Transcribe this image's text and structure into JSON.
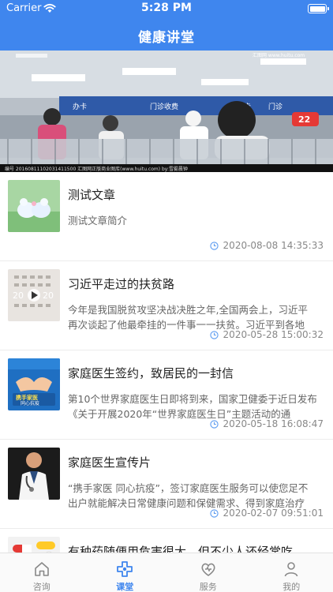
{
  "status_bar": {
    "carrier": "Carrier",
    "time": "5:28 PM"
  },
  "nav": {
    "title": "健康讲堂"
  },
  "banner": {
    "caption": "编号 20160811102031411500  汇图网正版商业图库(www.huitu.com) by:雪雾晨钟",
    "watermark": "汇图网 www.huitu.com",
    "sign_text": "门诊收费",
    "sign_number": "22"
  },
  "articles": [
    {
      "title": "测试文章",
      "summary": "测试文章简介",
      "date": "2020-08-08 14:35:33"
    },
    {
      "title": "习近平走过的扶贫路",
      "summary": "今年是我国脱贫攻坚决战决胜之年,全国两会上，习近平再次谈起了他最牵挂的一件事一一扶贫。习近平到各地考...",
      "date": "2020-05-28 15:00:32"
    },
    {
      "title": "家庭医生签约，致居民的一封信",
      "summary": "第10个世界家庭医生日即将到来，国家卫健委于近日发布《关于开展2020年“世界家庭医生日”主题活动的通知》...",
      "date": "2020-05-18 16:08:47"
    },
    {
      "title": "家庭医生宣传片",
      "summary": "“携手家医 同心抗疫”，签订家庭医生服务可以使您足不出户就能解决日常健康问题和保健需求、得到家庭治疗和...",
      "date": "2020-02-07 09:51:01"
    },
    {
      "title": "有种药随便用危害很大，但不少人还经常吃",
      "summary": "",
      "date": ""
    }
  ],
  "thumb_text": {
    "poster_line1": "携手家医",
    "poster_line2": "同心抗疫"
  },
  "tabs": [
    {
      "label": "咨询",
      "icon": "home-icon"
    },
    {
      "label": "课堂",
      "icon": "health-cross-icon"
    },
    {
      "label": "服务",
      "icon": "stethoscope-heart-icon"
    },
    {
      "label": "我的",
      "icon": "user-icon"
    }
  ],
  "colors": {
    "primary": "#3f86ee",
    "tab_inactive": "#888888"
  }
}
